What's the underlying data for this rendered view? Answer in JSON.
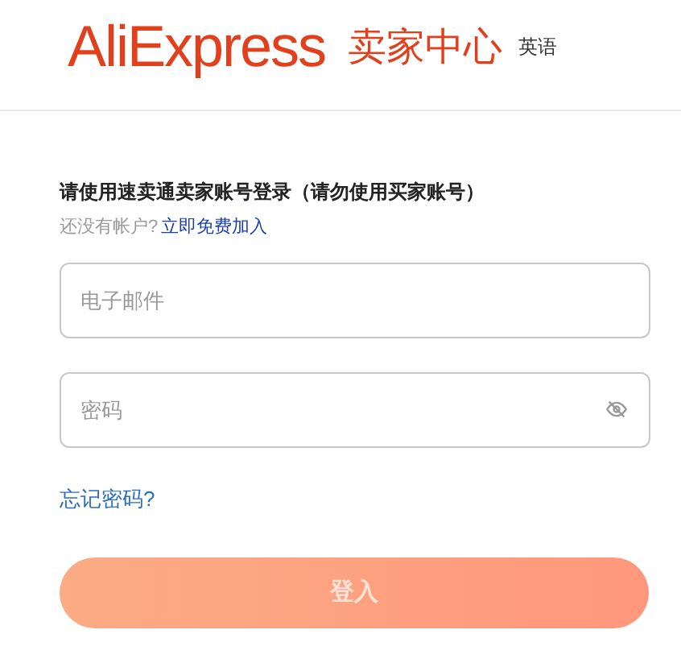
{
  "header": {
    "logo": "AliExpress",
    "subtitle": "卖家中心",
    "language": "英语"
  },
  "login": {
    "heading": "请使用速卖通卖家账号登录（请勿使用买家账号）",
    "signup_prompt": "还没有帐户?",
    "signup_link": "立即免费加入",
    "email": {
      "placeholder": "电子邮件"
    },
    "password": {
      "placeholder": "密码"
    },
    "forgot_link": "忘记密码?",
    "submit": {
      "label": "登入",
      "disabled": true
    }
  }
}
